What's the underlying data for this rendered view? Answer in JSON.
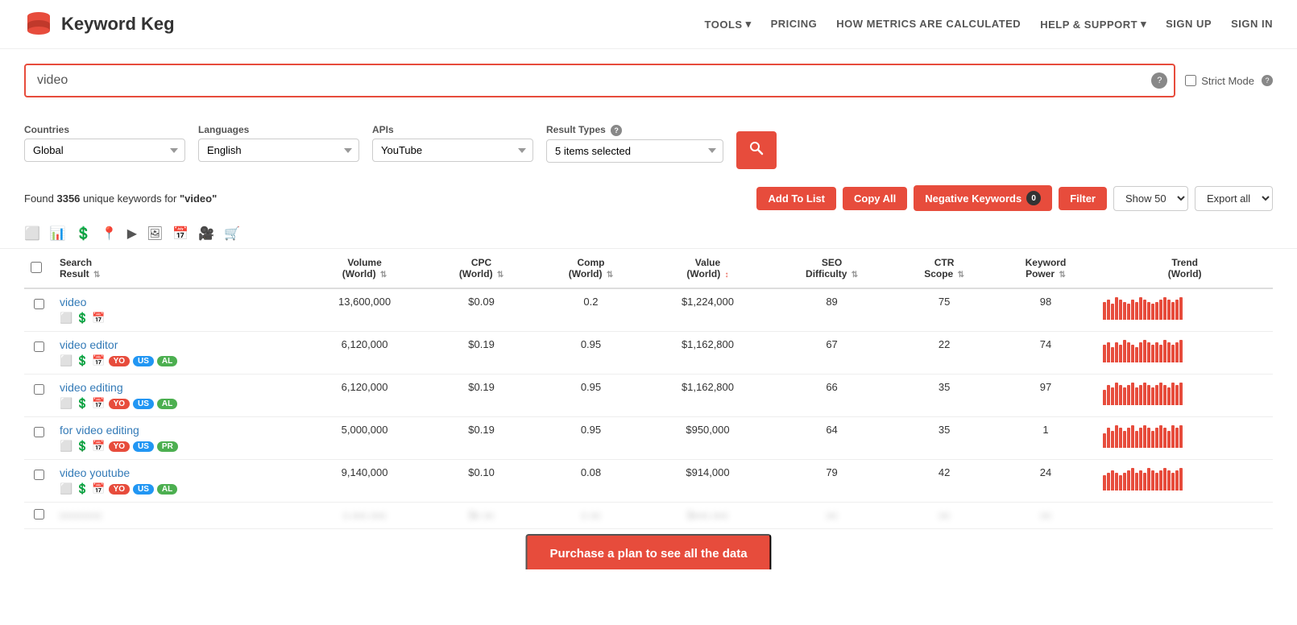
{
  "brand": {
    "name": "Keyword Keg"
  },
  "nav": {
    "tools": "TOOLS",
    "pricing": "PRICING",
    "metrics": "HOW METRICS ARE CALCULATED",
    "help": "HELP & SUPPORT",
    "signup": "SIGN UP",
    "signin": "SIGN IN"
  },
  "search": {
    "value": "video",
    "help_char": "?",
    "strict_mode_label": "Strict Mode"
  },
  "filters": {
    "countries_label": "Countries",
    "countries_value": "Global",
    "languages_label": "Languages",
    "languages_value": "English",
    "apis_label": "APIs",
    "apis_value": "YouTube",
    "result_types_label": "Result Types",
    "result_types_value": "5 items selected"
  },
  "results": {
    "count": "3356",
    "query": "video",
    "title_prefix": "Found ",
    "title_mid": " unique keywords for ",
    "add_to_list": "Add To List",
    "copy_all": "Copy All",
    "negative_keywords": "Negative Keywords",
    "neg_kw_count": "0",
    "filter": "Filter",
    "show_label": "Show 50",
    "export_label": "Export all"
  },
  "table": {
    "headers": [
      {
        "key": "search_result",
        "label": "Search\nResult",
        "align": "left",
        "sortable": true
      },
      {
        "key": "volume",
        "label": "Volume\n(World)",
        "align": "right",
        "sortable": true
      },
      {
        "key": "cpc",
        "label": "CPC\n(World)",
        "align": "right",
        "sortable": true
      },
      {
        "key": "comp",
        "label": "Comp\n(World)",
        "align": "right",
        "sortable": true
      },
      {
        "key": "value",
        "label": "Value\n(World)",
        "align": "right",
        "sortable": true,
        "active_sort": true
      },
      {
        "key": "seo",
        "label": "SEO\nDifficulty",
        "align": "right",
        "sortable": true
      },
      {
        "key": "ctr",
        "label": "CTR\nScope",
        "align": "right",
        "sortable": true
      },
      {
        "key": "kw_power",
        "label": "Keyword\nPower",
        "align": "right",
        "sortable": true
      },
      {
        "key": "trend",
        "label": "Trend\n(World)",
        "align": "right",
        "sortable": false
      }
    ],
    "rows": [
      {
        "keyword": "video",
        "volume": "13,600,000",
        "cpc": "$0.09",
        "comp": "0.2",
        "value": "$1,224,000",
        "seo": "89",
        "ctr": "75",
        "kw_power": "98",
        "badges": [],
        "trend_bars": [
          8,
          9,
          7,
          10,
          9,
          8,
          7,
          9,
          8,
          10,
          9,
          8,
          7,
          8,
          9,
          10,
          9,
          8,
          9,
          10
        ]
      },
      {
        "keyword": "video editor",
        "volume": "6,120,000",
        "cpc": "$0.19",
        "comp": "0.95",
        "value": "$1,162,800",
        "seo": "67",
        "ctr": "22",
        "kw_power": "74",
        "badges": [
          "YO",
          "US",
          "AL"
        ],
        "trend_bars": [
          7,
          8,
          6,
          8,
          7,
          9,
          8,
          7,
          6,
          8,
          9,
          8,
          7,
          8,
          7,
          9,
          8,
          7,
          8,
          9
        ]
      },
      {
        "keyword": "video editing",
        "volume": "6,120,000",
        "cpc": "$0.19",
        "comp": "0.95",
        "value": "$1,162,800",
        "seo": "66",
        "ctr": "35",
        "kw_power": "97",
        "badges": [
          "YO",
          "US",
          "AL"
        ],
        "trend_bars": [
          6,
          8,
          7,
          9,
          8,
          7,
          8,
          9,
          7,
          8,
          9,
          8,
          7,
          8,
          9,
          8,
          7,
          9,
          8,
          9
        ]
      },
      {
        "keyword": "for video editing",
        "volume": "5,000,000",
        "cpc": "$0.19",
        "comp": "0.95",
        "value": "$950,000",
        "seo": "64",
        "ctr": "35",
        "kw_power": "1",
        "badges": [
          "YO",
          "US",
          "PR"
        ],
        "trend_bars": [
          5,
          7,
          6,
          8,
          7,
          6,
          7,
          8,
          6,
          7,
          8,
          7,
          6,
          7,
          8,
          7,
          6,
          8,
          7,
          8
        ]
      },
      {
        "keyword": "video youtube",
        "volume": "9,140,000",
        "cpc": "$0.10",
        "comp": "0.08",
        "value": "$914,000",
        "seo": "79",
        "ctr": "42",
        "kw_power": "24",
        "badges": [
          "YO",
          "US",
          "AL"
        ],
        "trend_bars": [
          6,
          7,
          8,
          7,
          6,
          7,
          8,
          9,
          7,
          8,
          7,
          9,
          8,
          7,
          8,
          9,
          8,
          7,
          8,
          9
        ]
      }
    ],
    "blurred_row": {
      "keyword": "xxxxxxxx",
      "volume": "x,xxx,xxx",
      "cpc": "$x.xx",
      "comp": "x.xx",
      "value": "$xxx,xxx",
      "seo": "xx",
      "ctr": "xx",
      "kw_power": "xx"
    }
  },
  "purchase_banner": {
    "label": "Purchase a plan to see all the data"
  },
  "icons": {
    "copy": "📋",
    "chart": "📊",
    "dollar": "💲",
    "pin": "📍",
    "play": "▶",
    "image": "🖼",
    "calendar": "📅",
    "video": "🎥",
    "cart": "🛒",
    "search": "🔍",
    "sort": "⇅",
    "sort_active": "↕"
  }
}
